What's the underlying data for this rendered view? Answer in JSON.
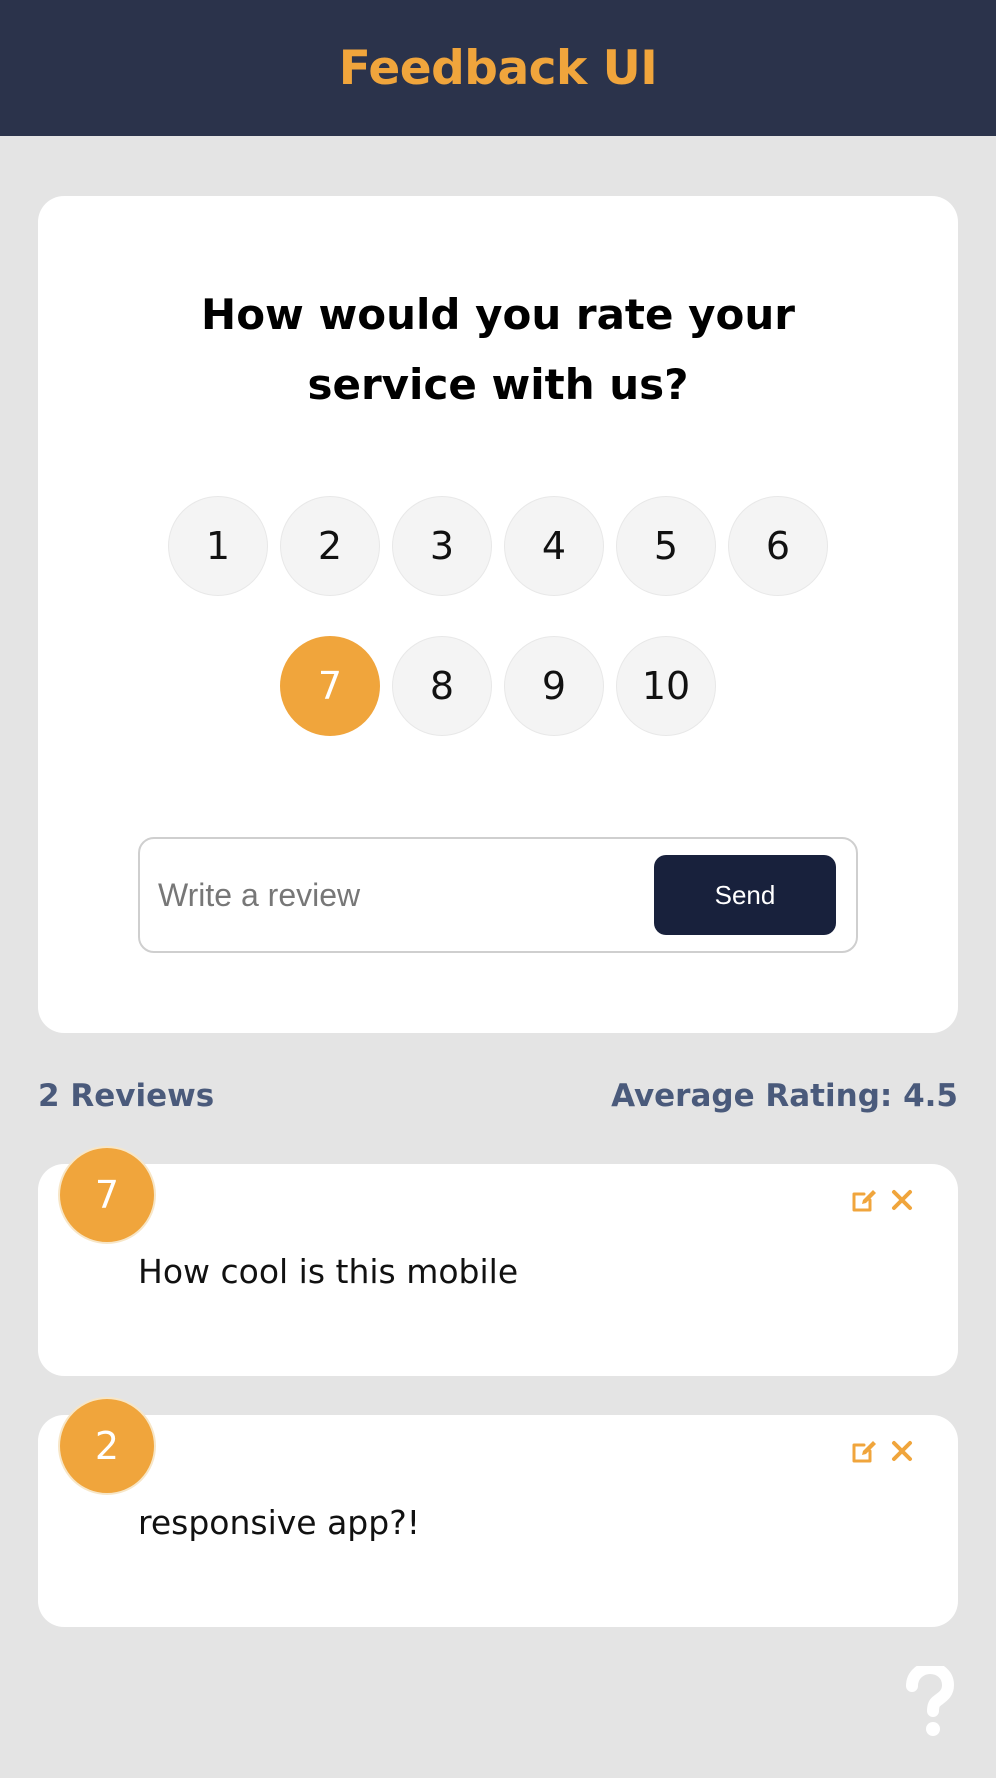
{
  "header": {
    "title": "Feedback UI"
  },
  "rating_card": {
    "question_line1": "How would you rate your",
    "question_line2": "service with us?",
    "ratings": [
      "1",
      "2",
      "3",
      "4",
      "5",
      "6",
      "7",
      "8",
      "9",
      "10"
    ],
    "selected_rating": "7",
    "review_placeholder": "Write a review",
    "send_label": "Send"
  },
  "stats": {
    "count_label": "2 Reviews",
    "average_label": "Average Rating: 4.5"
  },
  "reviews": [
    {
      "rating": "7",
      "text": "How cool is this mobile"
    },
    {
      "rating": "2",
      "text": "responsive app?!"
    }
  ],
  "icons": {
    "edit": "edit-icon",
    "delete": "close-icon",
    "help": "question-icon"
  },
  "colors": {
    "accent": "#f0a53c",
    "header_bg": "#2b334b",
    "send_bg": "#18213c",
    "stats_text": "#4a5a7b",
    "page_bg": "#e4e4e4"
  }
}
